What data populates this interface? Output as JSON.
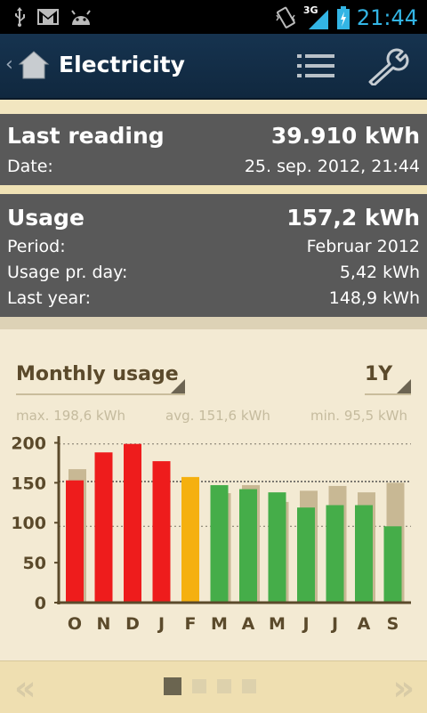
{
  "status_bar": {
    "time": "21:44",
    "network": "3G"
  },
  "app_bar": {
    "title": "Electricity"
  },
  "last_reading": {
    "heading": "Last reading",
    "value": "39.910 kWh",
    "date_label": "Date:",
    "date_value": "25. sep. 2012, 21:44"
  },
  "usage": {
    "heading": "Usage",
    "value": "157,2 kWh",
    "period_label": "Period:",
    "period_value": "Februar 2012",
    "per_day_label": "Usage pr. day:",
    "per_day_value": "5,42 kWh",
    "last_year_label": "Last year:",
    "last_year_value": "148,9 kWh"
  },
  "chart_panel": {
    "mode_label": "Monthly usage",
    "range_label": "1Y",
    "max_text": "max. 198,6 kWh",
    "avg_text": "avg. 151,6 kWh",
    "min_text": "min. 95,5 kWh"
  },
  "chart_data": {
    "type": "bar",
    "categories": [
      "O",
      "N",
      "D",
      "J",
      "F",
      "M",
      "A",
      "M",
      "J",
      "J",
      "A",
      "S"
    ],
    "series": [
      {
        "values": [
          153,
          188,
          198.6,
          177,
          157.2,
          147,
          142,
          138,
          119,
          122,
          122,
          95.5
        ],
        "colors": [
          "#ee1c1c",
          "#ee1c1c",
          "#ee1c1c",
          "#ee1c1c",
          "#f5b00f",
          "#45ad49",
          "#45ad49",
          "#45ad49",
          "#45ad49",
          "#45ad49",
          "#45ad49",
          "#45ad49"
        ]
      },
      {
        "values": [
          167,
          0,
          0,
          0,
          0,
          137,
          147,
          126,
          140,
          146,
          138,
          150
        ],
        "color": "#c8b894"
      }
    ],
    "yticks": [
      0,
      50,
      100,
      150,
      200
    ],
    "ylim": [
      0,
      215
    ],
    "reference_lines": {
      "max": 198.6,
      "avg": 151.6,
      "min": 95.5
    }
  },
  "pager": {
    "pages": 4,
    "active": 0
  }
}
